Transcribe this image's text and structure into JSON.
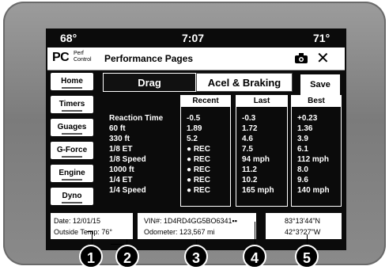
{
  "status": {
    "temp_left": "68°",
    "time": "7:07",
    "temp_right": "71°"
  },
  "header": {
    "logo_main": "PC",
    "logo_sub1": "Perf",
    "logo_sub2": "Control",
    "title": "Performance Pages",
    "camera_icon": "camera-icon",
    "close_label": "✕"
  },
  "sidebar": {
    "items": [
      {
        "label": "Home"
      },
      {
        "label": "Timers"
      },
      {
        "label": "Guages"
      },
      {
        "label": "G-Force"
      },
      {
        "label": "Engine"
      },
      {
        "label": "Dyno"
      }
    ]
  },
  "tabs": [
    {
      "label": "Drag"
    },
    {
      "label": "Acel & Braking"
    }
  ],
  "save_label": "Save",
  "table": {
    "columns": [
      "Recent",
      "Last",
      "Best"
    ],
    "rows": [
      {
        "label": "Reaction Time",
        "recent": "-0.5",
        "last": "-0.3",
        "best": "+0.23"
      },
      {
        "label": "60 ft",
        "recent": "1.89",
        "last": "1.72",
        "best": "1.36"
      },
      {
        "label": "330 ft",
        "recent": "5.2",
        "last": "4.6",
        "best": "3.9"
      },
      {
        "label": "1/8 ET",
        "recent": "● REC",
        "last": "7.5",
        "best": "6.1"
      },
      {
        "label": "1/8 Speed",
        "recent": "● REC",
        "last": "94 mph",
        "best": "112 mph"
      },
      {
        "label": "1000 ft",
        "recent": "● REC",
        "last": "11.2",
        "best": "8.0"
      },
      {
        "label": "1/4 ET",
        "recent": "● REC",
        "last": "10.2",
        "best": "9.6"
      },
      {
        "label": "1/4 Speed",
        "recent": "● REC",
        "last": "165 mph",
        "best": "140 mph"
      }
    ]
  },
  "info": {
    "date": "Date: 12/01/15",
    "outside_temp": "Outside Temp: 76°",
    "vin": "VIN#: 1D4RD4GG5BO6341▪▪",
    "odometer": "Odometer: 123,567 mi",
    "lat": "83°13'44\"N",
    "lon": "42°3?27\"W"
  },
  "callouts": [
    "1",
    "2",
    "3",
    "4",
    "5"
  ]
}
